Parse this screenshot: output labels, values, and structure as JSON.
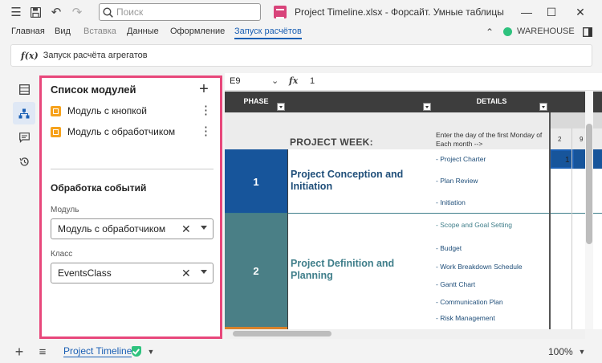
{
  "titlebar": {
    "search_placeholder": "Поиск",
    "doc_title": "Project Timeline.xlsx - Форсайт. Умные таблицы"
  },
  "menu": {
    "items": [
      "Главная",
      "Вид",
      "Вставка",
      "Данные",
      "Оформление",
      "Запуск расчётов"
    ],
    "active": "Запуск расчётов",
    "connection": "WAREHOUSE",
    "connection_status_color": "#2ec27e"
  },
  "ribbon": {
    "run_label": "Запуск расчёта агрегатов"
  },
  "panel": {
    "title": "Список модулей",
    "modules": [
      {
        "label": "Модуль с кнопкой"
      },
      {
        "label": "Модуль с обработчиком"
      }
    ],
    "events_title": "Обработка событий",
    "module_label": "Модуль",
    "module_value": "Модуль с обработчиком",
    "class_label": "Класс",
    "class_value": "EventsClass",
    "highlight_color": "#e8477b"
  },
  "formula": {
    "cell_ref": "E9",
    "value": "1"
  },
  "sheet": {
    "headers": {
      "phase": "PHASE",
      "details": "DETAILS"
    },
    "project_week": "PROJECT WEEK:",
    "enter_text": "Enter the day of the first Monday of Each month -->",
    "day_numbers": [
      "2",
      "9"
    ],
    "phases": [
      {
        "num": "1",
        "name": "Project Conception and Initiation",
        "color": "#17559b",
        "details": [
          "- Project Charter",
          "- Plan Review",
          "- Initiation"
        ]
      },
      {
        "num": "2",
        "name": "Project Definition and Planning",
        "color": "#4a7f86",
        "details": [
          "- Scope and Goal Setting",
          "- Budget",
          "- Work Breakdown Schedule",
          "- Gantt Chart",
          "- Communication Plan",
          "- Risk Management"
        ]
      }
    ],
    "selected_value": "1"
  },
  "bottom": {
    "sheet_tab": "Project Timeline",
    "zoom": "100%"
  }
}
